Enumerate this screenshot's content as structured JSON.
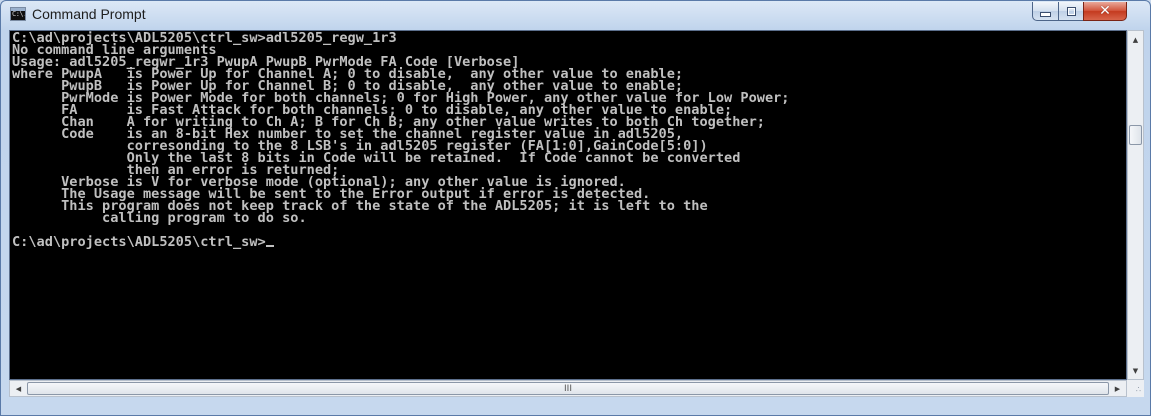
{
  "window": {
    "title": "Command Prompt",
    "icon_text": "C:\\."
  },
  "console": {
    "lines": [
      "C:\\ad\\projects\\ADL5205\\ctrl_sw>adl5205_regw_1r3",
      "No command line arguments",
      "Usage: adl5205_regwr_1r3 PwupA PwupB PwrMode FA Code [Verbose]",
      "where PwupA   is Power Up for Channel A; 0 to disable,  any other value to enable;",
      "      PwupB   is Power Up for Channel B; 0 to disable,  any other value to enable;",
      "      PwrMode is Power Mode for both channels; 0 for High Power, any other value for Low Power;",
      "      FA      is Fast Attack for both channels; 0 to disable, any other value to enable;",
      "      Chan    A for writing to Ch A; B for Ch B; any other value writes to both Ch together;",
      "      Code    is an 8-bit Hex number to set the channel register value in adl5205,",
      "              corresonding to the 8 LSB's in adl5205 register (FA[1:0],GainCode[5:0])",
      "              Only the last 8 bits in Code will be retained.  If Code cannot be converted",
      "              then an error is returned;",
      "      Verbose is V for verbose mode (optional); any other value is ignored.",
      "      The Usage message will be sent to the Error output if error is detected.",
      "      This program does not keep track of the state of the ADL5205; it is left to the",
      "           calling program to do so.",
      "",
      "C:\\ad\\projects\\ADL5205\\ctrl_sw>"
    ]
  },
  "scrollbars": {
    "up_arrow": "▲",
    "down_arrow": "▼",
    "left_arrow": "◀",
    "right_arrow": "▶",
    "hthumb_grip": "III",
    "size_grip": "∴"
  },
  "icons": {
    "window_icon": "console-icon",
    "minimize": "minimize-icon",
    "maximize": "maximize-icon",
    "close": "close-icon"
  },
  "close_glyph": "✕",
  "colors": {
    "console_bg": "#000000",
    "console_fg": "#c0c0c0",
    "close_button": "#c43a1f"
  }
}
